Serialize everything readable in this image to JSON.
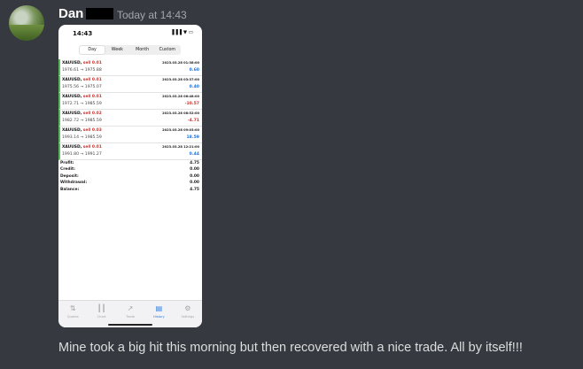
{
  "message": {
    "username": "Dan",
    "timestamp": "Today at 14:43",
    "text": "Mine took a big hit this morning but then recovered with a nice trade. All by itself!!!"
  },
  "phone": {
    "clock": "14:43",
    "status_icons": "▐▐▐ ▼ ▭",
    "tabs": [
      "Day",
      "Week",
      "Month",
      "Custom"
    ],
    "active_tab": "Day",
    "trades": [
      {
        "symbol": "XAUUSD,",
        "action": "sell 0.01",
        "date": "2023.03.28 01:38:00",
        "from": "1976.61",
        "to": "1975.88",
        "profit": "0.60",
        "sign": "pos"
      },
      {
        "symbol": "XAUUSD,",
        "action": "sell 0.01",
        "date": "2023.03.28 03:37:00",
        "from": "1975.56",
        "to": "1975.07",
        "profit": "0.40",
        "sign": "pos"
      },
      {
        "symbol": "XAUUSD,",
        "action": "sell 0.01",
        "date": "2023.03.28 06:48:00",
        "from": "1972.71",
        "to": "1985.59",
        "profit": "-10.57",
        "sign": "neg"
      },
      {
        "symbol": "XAUUSD,",
        "action": "sell 0.02",
        "date": "2023.03.28 08:52:00",
        "from": "1982.72",
        "to": "1985.59",
        "profit": "-4.71",
        "sign": "neg"
      },
      {
        "symbol": "XAUUSD,",
        "action": "sell 0.03",
        "date": "2023.03.28 09:03:00",
        "from": "1993.14",
        "to": "1985.59",
        "profit": "18.59",
        "sign": "pos"
      },
      {
        "symbol": "XAUUSD,",
        "action": "sell 0.01",
        "date": "2023.03.28 12:21:00",
        "from": "1991.80",
        "to": "1991.27",
        "profit": "0.44",
        "sign": "pos"
      }
    ],
    "summary": [
      {
        "label": "Profit:",
        "value": "4.75"
      },
      {
        "label": "Credit:",
        "value": "0.00"
      },
      {
        "label": "Deposit:",
        "value": "0.00"
      },
      {
        "label": "Withdrawal:",
        "value": "0.00"
      },
      {
        "label": "Balance:",
        "value": "4.75"
      }
    ],
    "tabbar": [
      {
        "label": "Quotes",
        "icon": "quotes-icon",
        "glyph": "⇅"
      },
      {
        "label": "Chart",
        "icon": "chart-icon",
        "glyph": "┃┃"
      },
      {
        "label": "Trade",
        "icon": "trade-icon",
        "glyph": "↗"
      },
      {
        "label": "History",
        "icon": "history-icon",
        "glyph": "▤",
        "active": true
      },
      {
        "label": "Settings",
        "icon": "gear-icon",
        "glyph": "⚙"
      }
    ],
    "colors": {
      "positive": "#1e6fd9",
      "negative": "#d0312d",
      "active_tab": "#2f7de1"
    }
  }
}
